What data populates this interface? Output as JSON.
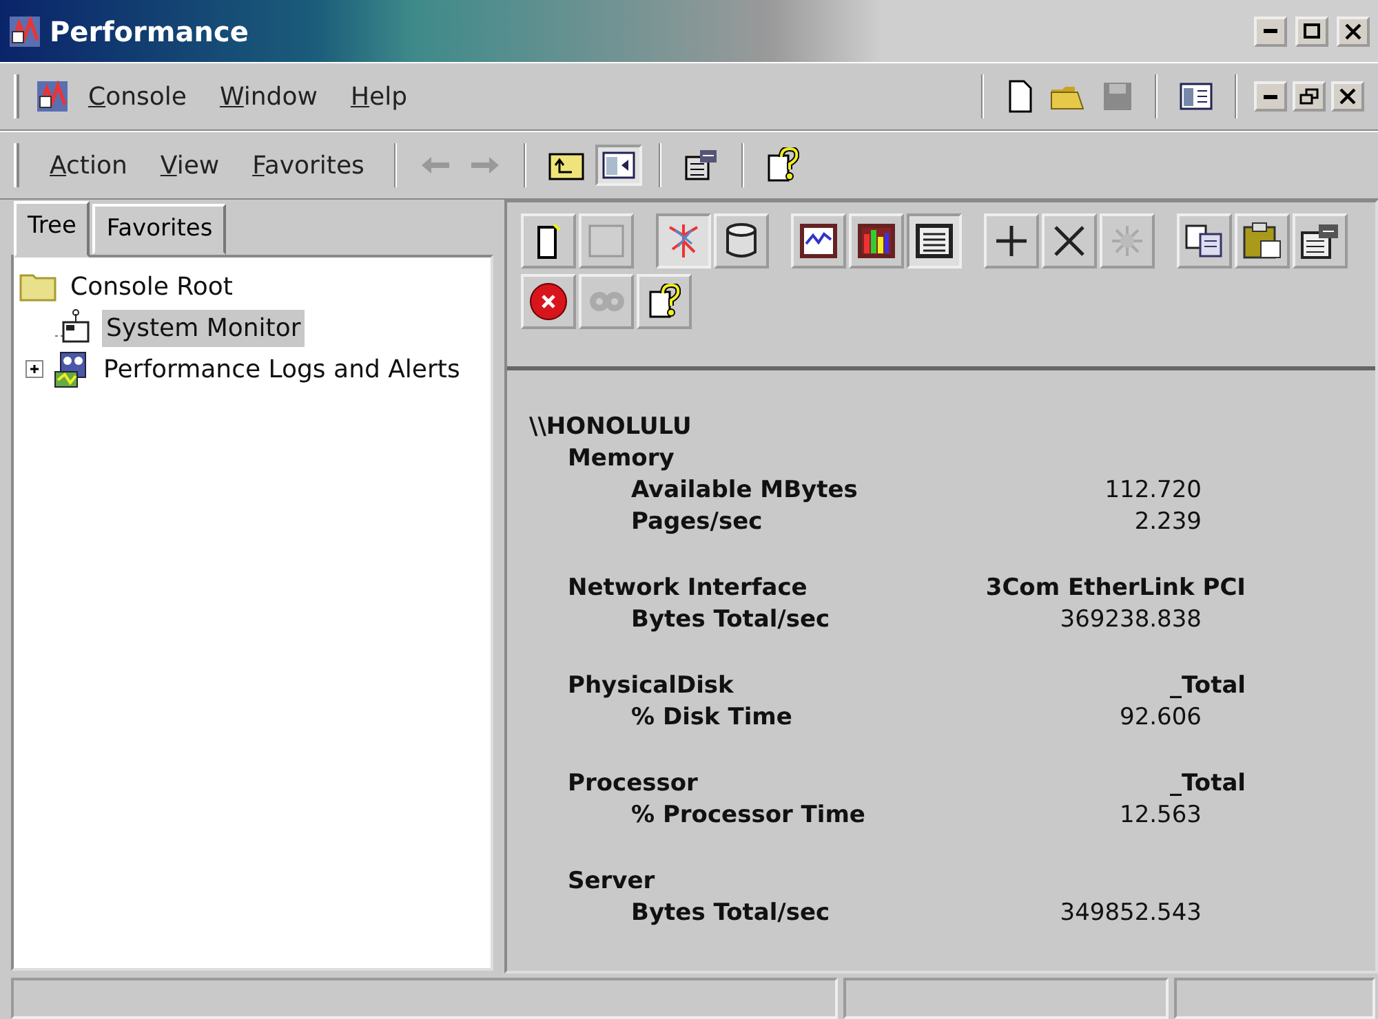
{
  "window": {
    "title": "Performance"
  },
  "menu_bar": {
    "items": [
      {
        "label": "Console"
      },
      {
        "label": "Window"
      },
      {
        "label": "Help"
      }
    ]
  },
  "action_bar": {
    "items": [
      {
        "label": "Action"
      },
      {
        "label": "View"
      },
      {
        "label": "Favorites"
      }
    ]
  },
  "tabs": [
    {
      "label": "Tree",
      "selected": true
    },
    {
      "label": "Favorites",
      "selected": false
    }
  ],
  "tree": {
    "label": "Console Root",
    "children": [
      {
        "label": "System Monitor",
        "selected": true,
        "kind": "monitor"
      },
      {
        "label": "Performance Logs and Alerts",
        "selected": false,
        "expanded": false,
        "kind": "logs"
      }
    ]
  },
  "report": {
    "machine": "\\\\HONOLULU",
    "objects": [
      {
        "name": "Memory",
        "counters": [
          {
            "name": "Available MBytes",
            "value": "112.720"
          },
          {
            "name": "Pages/sec",
            "value": "2.239"
          }
        ]
      },
      {
        "name": "Network Interface",
        "instance": "3Com EtherLink PCI",
        "counters": [
          {
            "name": "Bytes Total/sec",
            "value": "369238.838"
          }
        ]
      },
      {
        "name": "PhysicalDisk",
        "instance": "_Total",
        "counters": [
          {
            "name": "% Disk Time",
            "value": "92.606"
          }
        ]
      },
      {
        "name": "Processor",
        "instance": "_Total",
        "counters": [
          {
            "name": "% Processor Time",
            "value": "12.563"
          }
        ]
      },
      {
        "name": "Server",
        "counters": [
          {
            "name": "Bytes Total/sec",
            "value": "349852.543"
          }
        ]
      }
    ]
  }
}
